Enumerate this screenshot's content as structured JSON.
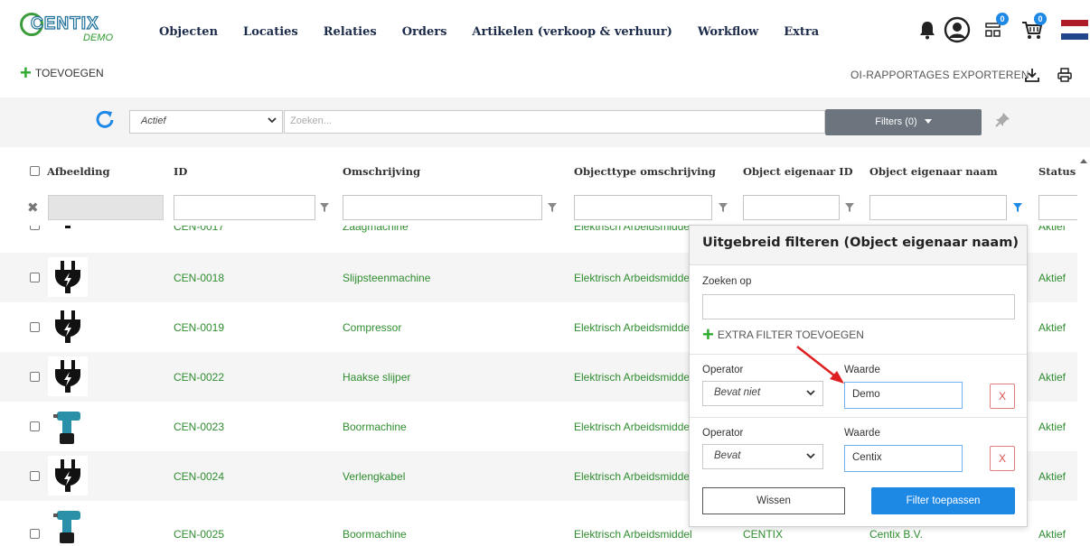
{
  "brand": {
    "logo_text": "CENTIX",
    "logo_sub": "DEMO"
  },
  "nav": {
    "items": [
      "Objecten",
      "Locaties",
      "Relaties",
      "Orders",
      "Artikelen (verkoop & verhuur)",
      "Workflow",
      "Extra"
    ],
    "badges": {
      "scan": "0",
      "cart": "0"
    },
    "icons": [
      "bell-icon",
      "user-avatar-icon",
      "scan-icon",
      "cart-icon",
      "dutch-flag-icon"
    ]
  },
  "toolbar": {
    "add_label": "TOEVOEGEN",
    "export_label": "OI-RAPPORTAGES EXPORTEREN"
  },
  "filterbar": {
    "status_value": "Actief",
    "search_placeholder": "Zoeken...",
    "filters_label": "Filters (0)"
  },
  "table": {
    "columns": [
      "Afbeelding",
      "ID",
      "Omschrijving",
      "Objecttype omschrijving",
      "Object eigenaar ID",
      "Object eigenaar naam",
      "Status"
    ],
    "partial_row": {
      "id": "CEN-0017",
      "omschrijving": "Zaagmachine",
      "type": "Elektrisch Arbeidsmiddel",
      "status": "Aktief"
    },
    "rows": [
      {
        "image": "plug",
        "id": "CEN-0018",
        "omschrijving": "Slijpsteenmachine",
        "type": "Elektrisch Arbeidsmiddel",
        "owner_id": "",
        "owner_name": "",
        "status": "Aktief"
      },
      {
        "image": "plug",
        "id": "CEN-0019",
        "omschrijving": "Compressor",
        "type": "Elektrisch Arbeidsmiddel",
        "owner_id": "",
        "owner_name": "",
        "status": "Aktief"
      },
      {
        "image": "plug",
        "id": "CEN-0022",
        "omschrijving": "Haakse slijper",
        "type": "Elektrisch Arbeidsmiddel",
        "owner_id": "",
        "owner_name": "",
        "status": "Aktief"
      },
      {
        "image": "drill",
        "id": "CEN-0023",
        "omschrijving": "Boormachine",
        "type": "Elektrisch Arbeidsmiddel",
        "owner_id": "",
        "owner_name": "",
        "status": "Aktief"
      },
      {
        "image": "plug",
        "id": "CEN-0024",
        "omschrijving": "Verlengkabel",
        "type": "Elektrisch Arbeidsmiddel",
        "owner_id": "",
        "owner_name": "",
        "status": "Aktief"
      },
      {
        "image": "drill",
        "id": "CEN-0025",
        "omschrijving": "Boormachine",
        "type": "Elektrisch Arbeidsmiddel",
        "owner_id": "CENTIX",
        "owner_name": "Centix B.V.",
        "status": "Aktief"
      }
    ]
  },
  "popup": {
    "title": "Uitgebreid filteren (Object eigenaar naam)",
    "search_label": "Zoeken op",
    "search_value": "",
    "add_filter_label": "EXTRA FILTER TOEVOEGEN",
    "filters": [
      {
        "operator_label": "Operator",
        "operator": "Bevat niet",
        "value_label": "Waarde",
        "value": "Demo",
        "remove": "X"
      },
      {
        "operator_label": "Operator",
        "operator": "Bevat",
        "value_label": "Waarde",
        "value": "Centix",
        "remove": "X"
      }
    ],
    "clear_label": "Wissen",
    "apply_label": "Filter toepassen"
  },
  "colors": {
    "accent": "#1e88e5",
    "link_green": "#2f8d2f",
    "add_green": "#2eaa2e",
    "remove_red": "#d9534f",
    "annotation_red": "#e02020"
  }
}
